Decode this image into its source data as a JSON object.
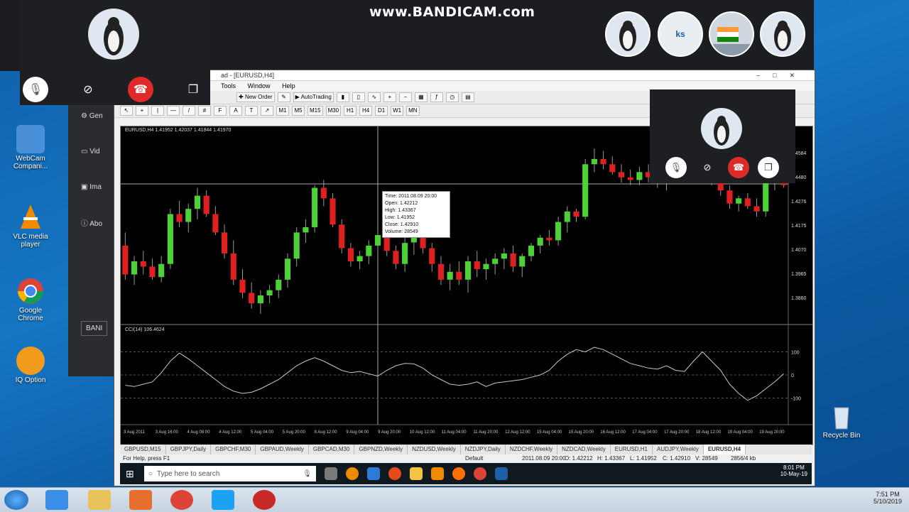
{
  "watermark": "www.BANDICAM.com",
  "desktop_icons": [
    {
      "label": "WebCam Compani...",
      "color": "#4a90d9"
    },
    {
      "label": "VLC media player",
      "color": "#f08a00"
    },
    {
      "label": "Google Chrome",
      "color": "#db4437"
    },
    {
      "label": "IQ Option",
      "color": "#f29b1c"
    }
  ],
  "desktop_right": {
    "recycle_label": "Recycle Bin"
  },
  "avatars": {
    "initials": "ks"
  },
  "side_panel": {
    "items": [
      "Gen",
      "Vid",
      "Ima",
      "Abo"
    ],
    "button": "BANI"
  },
  "mt4": {
    "window_title": "ad - [EURUSD,H4]",
    "menu": [
      "Tools",
      "Window",
      "Help"
    ],
    "toolbar": {
      "new_order": "New Order",
      "autotrading": "AutoTrading"
    },
    "timeframes": [
      "M1",
      "M5",
      "M15",
      "M30",
      "H1",
      "H4",
      "D1",
      "W1",
      "MN"
    ],
    "chart_header": "EURUSD,H4 1.41952 1.42037 1.41844 1.41970",
    "indicator_label": "CCI(14) 106.4624",
    "tooltip": {
      "time": "Time: 2011.08.09 20:00",
      "open": "Open: 1.42212",
      "high": "High: 1.43367",
      "low": "Low: 1.41952",
      "close": "Close: 1.42910",
      "volume": "Volume: 28549"
    },
    "price_labels": [
      "1.4584",
      "1.4480",
      "1.4276",
      "1.4175",
      "1.4070",
      "1.3965",
      "1.3860"
    ],
    "cci_labels": [
      "100",
      "0",
      "-100"
    ],
    "time_labels": [
      "3 Aug 2011",
      "3 Aug 16:00",
      "4 Aug 08:00",
      "4 Aug 12:00",
      "5 Aug 04:00",
      "5 Aug 20:00",
      "8 Aug 12:00",
      "9 Aug 04:00",
      "9 Aug 20:00",
      "10 Aug 12:00",
      "11 Aug 04:00",
      "11 Aug 20:00",
      "12 Aug 12:00",
      "15 Aug 04:00",
      "15 Aug 20:00",
      "16 Aug 12:00",
      "17 Aug 04:00",
      "17 Aug 20:00",
      "18 Aug 12:00",
      "19 Aug 04:00",
      "19 Aug 20:00"
    ],
    "symbol_tabs": [
      "GBPUSD,M15",
      "GBPJPY,Daily",
      "GBPCHF,M30",
      "GBPAUD,Weekly",
      "GBPCAD,M30",
      "GBPNZD,Weekly",
      "NZDUSD,Weekly",
      "NZDJPY,Daily",
      "NZDCHF,Weekly",
      "NZDCAD,Weekly",
      "EURUSD,H1",
      "AUDJPY,Weekly",
      "EURUSD,H4"
    ],
    "active_tab": "EURUSD,H4",
    "status": {
      "help": "For Help, press F1",
      "profile": "Default",
      "datetime": "2011.08.09 20:00",
      "open": "O: 1.42212",
      "high": "H: 1.43367",
      "low": "L: 1.41952",
      "close": "C: 1.42910",
      "volume": "V: 28549",
      "traffic": "2856/4 kb"
    }
  },
  "vm_taskbar": {
    "search_placeholder": "Type here to search",
    "time": "8:01 PM",
    "date": "10-May-19"
  },
  "win7_taskbar": {
    "time": "7:51 PM",
    "date": "5/10/2019"
  },
  "chart_data": {
    "type": "candlestick",
    "candles": [
      {
        "o": 1.423,
        "h": 1.428,
        "l": 1.41,
        "c": 1.412
      },
      {
        "o": 1.412,
        "h": 1.419,
        "l": 1.408,
        "c": 1.417
      },
      {
        "o": 1.417,
        "h": 1.421,
        "l": 1.412,
        "c": 1.415
      },
      {
        "o": 1.415,
        "h": 1.418,
        "l": 1.41,
        "c": 1.411
      },
      {
        "o": 1.411,
        "h": 1.419,
        "l": 1.409,
        "c": 1.416
      },
      {
        "o": 1.416,
        "h": 1.437,
        "l": 1.414,
        "c": 1.435
      },
      {
        "o": 1.435,
        "h": 1.44,
        "l": 1.43,
        "c": 1.432
      },
      {
        "o": 1.432,
        "h": 1.439,
        "l": 1.428,
        "c": 1.437
      },
      {
        "o": 1.437,
        "h": 1.445,
        "l": 1.433,
        "c": 1.442
      },
      {
        "o": 1.442,
        "h": 1.444,
        "l": 1.434,
        "c": 1.435
      },
      {
        "o": 1.435,
        "h": 1.438,
        "l": 1.427,
        "c": 1.428
      },
      {
        "o": 1.428,
        "h": 1.431,
        "l": 1.418,
        "c": 1.42
      },
      {
        "o": 1.42,
        "h": 1.425,
        "l": 1.408,
        "c": 1.41
      },
      {
        "o": 1.41,
        "h": 1.414,
        "l": 1.403,
        "c": 1.405
      },
      {
        "o": 1.405,
        "h": 1.409,
        "l": 1.399,
        "c": 1.401
      },
      {
        "o": 1.401,
        "h": 1.406,
        "l": 1.397,
        "c": 1.404
      },
      {
        "o": 1.404,
        "h": 1.408,
        "l": 1.401,
        "c": 1.406
      },
      {
        "o": 1.406,
        "h": 1.412,
        "l": 1.403,
        "c": 1.41
      },
      {
        "o": 1.41,
        "h": 1.42,
        "l": 1.407,
        "c": 1.418
      },
      {
        "o": 1.418,
        "h": 1.43,
        "l": 1.415,
        "c": 1.428
      },
      {
        "o": 1.428,
        "h": 1.433,
        "l": 1.424,
        "c": 1.43
      },
      {
        "o": 1.43,
        "h": 1.446,
        "l": 1.428,
        "c": 1.445
      },
      {
        "o": 1.445,
        "h": 1.448,
        "l": 1.438,
        "c": 1.441
      },
      {
        "o": 1.441,
        "h": 1.443,
        "l": 1.43,
        "c": 1.431
      },
      {
        "o": 1.431,
        "h": 1.433,
        "l": 1.42,
        "c": 1.422
      },
      {
        "o": 1.422,
        "h": 1.424,
        "l": 1.415,
        "c": 1.417
      },
      {
        "o": 1.417,
        "h": 1.421,
        "l": 1.414,
        "c": 1.419
      },
      {
        "o": 1.419,
        "h": 1.425,
        "l": 1.416,
        "c": 1.423
      },
      {
        "o": 1.423,
        "h": 1.429,
        "l": 1.421,
        "c": 1.427
      },
      {
        "o": 1.427,
        "h": 1.43,
        "l": 1.419,
        "c": 1.421
      },
      {
        "o": 1.421,
        "h": 1.423,
        "l": 1.414,
        "c": 1.416
      },
      {
        "o": 1.416,
        "h": 1.426,
        "l": 1.413,
        "c": 1.424
      },
      {
        "o": 1.4242,
        "h": 1.4337,
        "l": 1.4195,
        "c": 1.4291
      },
      {
        "o": 1.4291,
        "h": 1.43,
        "l": 1.42,
        "c": 1.422
      },
      {
        "o": 1.422,
        "h": 1.424,
        "l": 1.413,
        "c": 1.416
      },
      {
        "o": 1.416,
        "h": 1.419,
        "l": 1.408,
        "c": 1.41
      },
      {
        "o": 1.41,
        "h": 1.416,
        "l": 1.406,
        "c": 1.413
      },
      {
        "o": 1.413,
        "h": 1.417,
        "l": 1.408,
        "c": 1.41
      },
      {
        "o": 1.41,
        "h": 1.419,
        "l": 1.405,
        "c": 1.417
      },
      {
        "o": 1.417,
        "h": 1.421,
        "l": 1.411,
        "c": 1.414
      },
      {
        "o": 1.414,
        "h": 1.418,
        "l": 1.41,
        "c": 1.416
      },
      {
        "o": 1.416,
        "h": 1.42,
        "l": 1.412,
        "c": 1.418
      },
      {
        "o": 1.418,
        "h": 1.422,
        "l": 1.414,
        "c": 1.42
      },
      {
        "o": 1.42,
        "h": 1.423,
        "l": 1.413,
        "c": 1.415
      },
      {
        "o": 1.415,
        "h": 1.42,
        "l": 1.411,
        "c": 1.419
      },
      {
        "o": 1.419,
        "h": 1.424,
        "l": 1.417,
        "c": 1.423
      },
      {
        "o": 1.423,
        "h": 1.427,
        "l": 1.42,
        "c": 1.426
      },
      {
        "o": 1.426,
        "h": 1.429,
        "l": 1.423,
        "c": 1.425
      },
      {
        "o": 1.425,
        "h": 1.434,
        "l": 1.423,
        "c": 1.432
      },
      {
        "o": 1.432,
        "h": 1.438,
        "l": 1.428,
        "c": 1.436
      },
      {
        "o": 1.436,
        "h": 1.437,
        "l": 1.432,
        "c": 1.434
      },
      {
        "o": 1.434,
        "h": 1.456,
        "l": 1.433,
        "c": 1.454
      },
      {
        "o": 1.454,
        "h": 1.46,
        "l": 1.451,
        "c": 1.456
      },
      {
        "o": 1.456,
        "h": 1.459,
        "l": 1.452,
        "c": 1.454
      },
      {
        "o": 1.454,
        "h": 1.457,
        "l": 1.45,
        "c": 1.451
      },
      {
        "o": 1.451,
        "h": 1.454,
        "l": 1.447,
        "c": 1.449
      },
      {
        "o": 1.449,
        "h": 1.452,
        "l": 1.446,
        "c": 1.448
      },
      {
        "o": 1.448,
        "h": 1.453,
        "l": 1.446,
        "c": 1.451
      },
      {
        "o": 1.451,
        "h": 1.454,
        "l": 1.447,
        "c": 1.449
      },
      {
        "o": 1.449,
        "h": 1.451,
        "l": 1.445,
        "c": 1.447
      },
      {
        "o": 1.447,
        "h": 1.452,
        "l": 1.444,
        "c": 1.45
      },
      {
        "o": 1.45,
        "h": 1.456,
        "l": 1.448,
        "c": 1.454
      },
      {
        "o": 1.454,
        "h": 1.458,
        "l": 1.45,
        "c": 1.452
      },
      {
        "o": 1.452,
        "h": 1.455,
        "l": 1.449,
        "c": 1.451
      },
      {
        "o": 1.451,
        "h": 1.453,
        "l": 1.447,
        "c": 1.449
      },
      {
        "o": 1.449,
        "h": 1.452,
        "l": 1.446,
        "c": 1.45
      },
      {
        "o": 1.45,
        "h": 1.453,
        "l": 1.442,
        "c": 1.444
      },
      {
        "o": 1.444,
        "h": 1.446,
        "l": 1.437,
        "c": 1.439
      },
      {
        "o": 1.439,
        "h": 1.442,
        "l": 1.436,
        "c": 1.441
      },
      {
        "o": 1.441,
        "h": 1.443,
        "l": 1.437,
        "c": 1.438
      },
      {
        "o": 1.438,
        "h": 1.441,
        "l": 1.434,
        "c": 1.436
      },
      {
        "o": 1.436,
        "h": 1.448,
        "l": 1.434,
        "c": 1.447
      },
      {
        "o": 1.447,
        "h": 1.45,
        "l": 1.444,
        "c": 1.448
      },
      {
        "o": 1.448,
        "h": 1.449,
        "l": 1.445,
        "c": 1.446
      }
    ],
    "cci": [
      -45,
      -50,
      -40,
      -30,
      10,
      60,
      95,
      70,
      40,
      10,
      -20,
      -50,
      -70,
      -80,
      -75,
      -60,
      -40,
      -20,
      10,
      40,
      60,
      75,
      60,
      40,
      20,
      10,
      15,
      5,
      -5,
      20,
      40,
      50,
      48,
      30,
      0,
      -20,
      -40,
      -45,
      -40,
      -30,
      -50,
      -35,
      -30,
      -25,
      -20,
      -10,
      0,
      20,
      60,
      90,
      110,
      100,
      120,
      110,
      90,
      70,
      50,
      40,
      30,
      25,
      40,
      20,
      15,
      60,
      100,
      60,
      20,
      -40,
      -80,
      -110,
      -90,
      -60,
      -30,
      5
    ]
  }
}
